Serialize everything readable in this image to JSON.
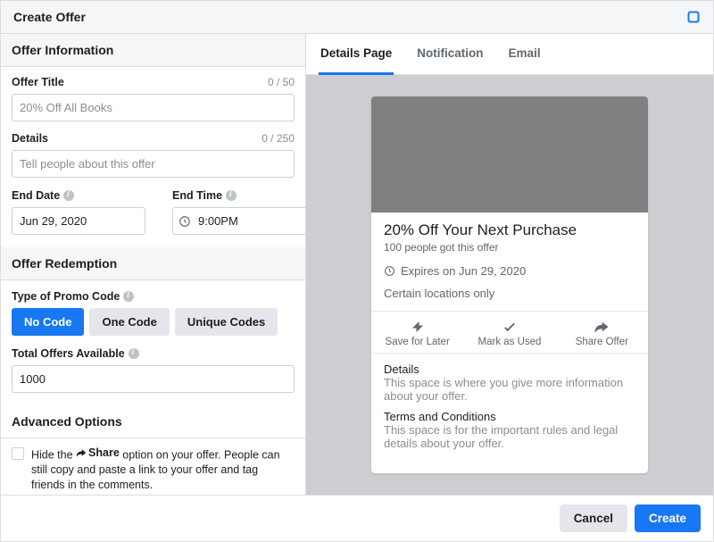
{
  "header": {
    "title": "Create Offer"
  },
  "sections": {
    "info": "Offer Information",
    "redemption": "Offer Redemption",
    "advanced": "Advanced Options"
  },
  "offer_title": {
    "label": "Offer Title",
    "counter": "0 / 50",
    "placeholder": "20% Off All Books",
    "value": ""
  },
  "details": {
    "label": "Details",
    "counter": "0 / 250",
    "placeholder": "Tell people about this offer",
    "value": ""
  },
  "end_date": {
    "label": "End Date",
    "value": "Jun 29, 2020"
  },
  "end_time": {
    "label": "End Time",
    "value": "9:00PM"
  },
  "promo": {
    "label": "Type of Promo Code",
    "options": {
      "no_code": "No Code",
      "one_code": "One Code",
      "unique": "Unique Codes"
    }
  },
  "total_offers": {
    "label": "Total Offers Available",
    "value": "1000"
  },
  "adv": {
    "hide_pre": "Hide the",
    "hide_share_word": "Share",
    "hide_post": "option on your offer. People can still copy and paste a link to your offer and tag friends in the comments."
  },
  "tabs": {
    "details": "Details Page",
    "notification": "Notification",
    "email": "Email"
  },
  "preview": {
    "title": "20% Off Your Next Purchase",
    "sub": "100 people got this offer",
    "expires": "Expires on Jun 29, 2020",
    "locations": "Certain locations only",
    "actions": {
      "save": "Save for Later",
      "mark": "Mark as Used",
      "share": "Share Offer"
    },
    "details_h": "Details",
    "details_t": "This space is where you give more information about your offer.",
    "terms_h": "Terms and Conditions",
    "terms_t": "This space is for the important rules and legal details about your offer."
  },
  "footer": {
    "cancel": "Cancel",
    "create": "Create"
  }
}
